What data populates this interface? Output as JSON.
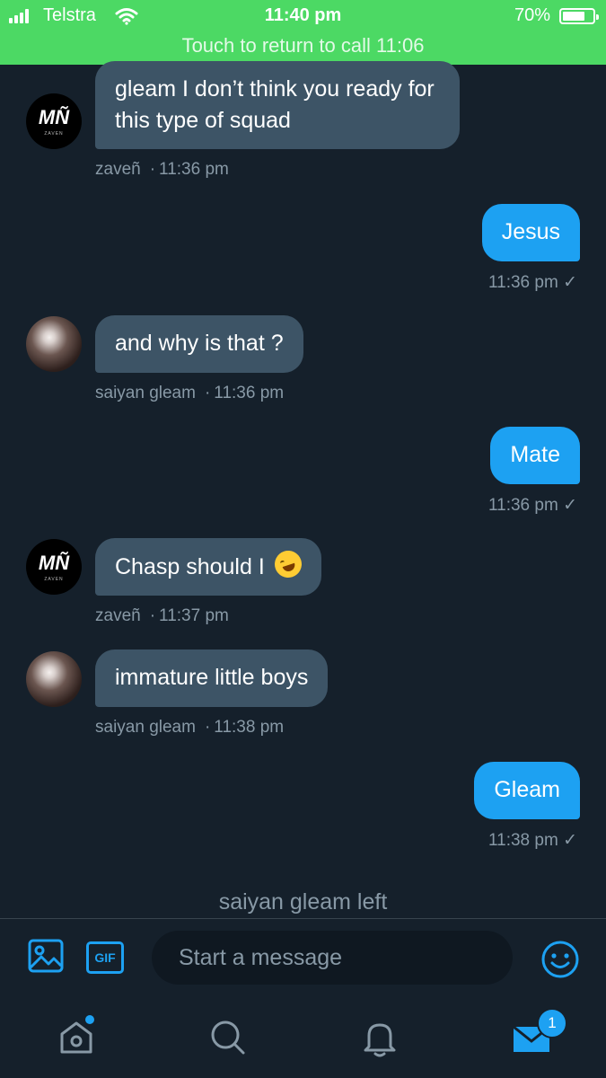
{
  "status_bar": {
    "carrier": "Telstra",
    "time": "11:40 pm",
    "battery_pct": "70%",
    "call_banner": "Touch to return to call 11:06"
  },
  "messages": [
    {
      "direction": "in",
      "text": "gleam I don’t think you ready for this type of squad",
      "sender": "zaveñ",
      "time": "11:36 pm",
      "avatar": "logo"
    },
    {
      "direction": "out",
      "text": "Jesus",
      "time": "11:36 pm",
      "status": "✓"
    },
    {
      "direction": "in",
      "text": "and why is that ?",
      "sender": "saiyan gleam",
      "time": "11:36 pm",
      "avatar": "photo"
    },
    {
      "direction": "out",
      "text": "Mate",
      "time": "11:36 pm",
      "status": "✓"
    },
    {
      "direction": "in",
      "text": "Chasp should I",
      "emoji": "rolling-on-floor-laughing",
      "sender": "zaveñ",
      "time": "11:37 pm",
      "avatar": "logo"
    },
    {
      "direction": "in",
      "text": "immature little boys",
      "sender": "saiyan gleam",
      "time": "11:38 pm",
      "avatar": "photo"
    },
    {
      "direction": "out",
      "text": "Gleam",
      "time": "11:38 pm",
      "status": "✓"
    }
  ],
  "logo_avatar": {
    "letters": "MÑ",
    "sub": "ZAVEN"
  },
  "meta_separator": "·",
  "system_note": "saiyan gleam left",
  "composer": {
    "gif_label": "GIF",
    "placeholder": "Start a message"
  },
  "tabbar": {
    "messages_badge": "1",
    "icons": [
      "home-icon",
      "search-icon",
      "bell-icon",
      "mail-icon"
    ]
  },
  "colors": {
    "background": "#15202b",
    "incoming_bubble": "#3d5466",
    "outgoing_bubble": "#1da1f2",
    "status_bar": "#4cd964",
    "meta_text": "#8899a6"
  }
}
